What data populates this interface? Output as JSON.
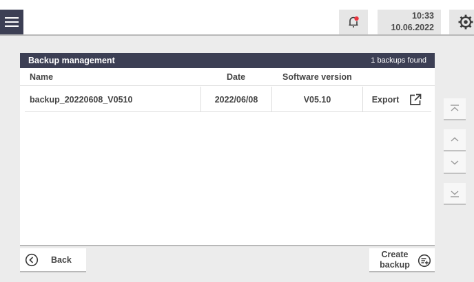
{
  "header": {
    "time": "10:33",
    "date": "10.06.2022",
    "menu_icon": "hamburger-icon",
    "notification_icon": "bell-icon",
    "notification_dot_color": "#e8343f",
    "settings_icon": "gear-icon"
  },
  "panel": {
    "title": "Backup management",
    "count_text": "1 backups found",
    "columns": {
      "name": "Name",
      "date": "Date",
      "version": "Software version"
    },
    "rows": [
      {
        "name": "backup_20220608_V0510",
        "date": "2022/06/08",
        "version": "V05.10",
        "action": "Export"
      }
    ]
  },
  "footer": {
    "back_label": "Back",
    "create_label_line1": "Create",
    "create_label_line2": "backup"
  },
  "colors": {
    "header_bar": "#3c3f54",
    "background": "#ececec"
  }
}
